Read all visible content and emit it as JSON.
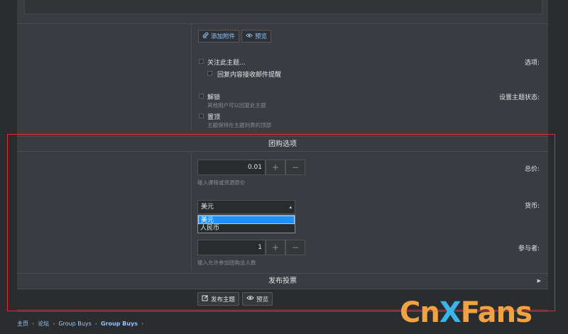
{
  "attach": {
    "add_attachment": "添加附件",
    "preview": "预览"
  },
  "options": {
    "label": "选项:",
    "watch": "关注此主题...",
    "email_notify": "回复内容接收邮件提醒"
  },
  "status": {
    "label": "设置主题状态:",
    "unlock": "解锁",
    "unlock_hint": "其他用户可以回复此主题",
    "sticky": "置顶",
    "sticky_hint": "主题保持在主题列表的顶部"
  },
  "group_buy": {
    "section_title": "团购选项",
    "total_label": "总价:",
    "total_value": "0.01",
    "total_hint": "输入课程或资源原价",
    "currency_label": "货币:",
    "currency_selected": "美元",
    "currency_options": [
      "美元",
      "人民币"
    ],
    "participants_label": "参与者:",
    "participants_value": "1",
    "participants_hint": "输入允许参加团购总人数",
    "plus": "+",
    "minus": "−"
  },
  "poll": {
    "title": "发布投票"
  },
  "footer": {
    "post_thread": "发布主题",
    "preview": "预览"
  },
  "breadcrumb": [
    "主页",
    "论坛",
    "Group Buys",
    "Group Buys"
  ],
  "logo": {
    "part1": "Cn",
    "part2": "X",
    "part3": "Fans"
  }
}
